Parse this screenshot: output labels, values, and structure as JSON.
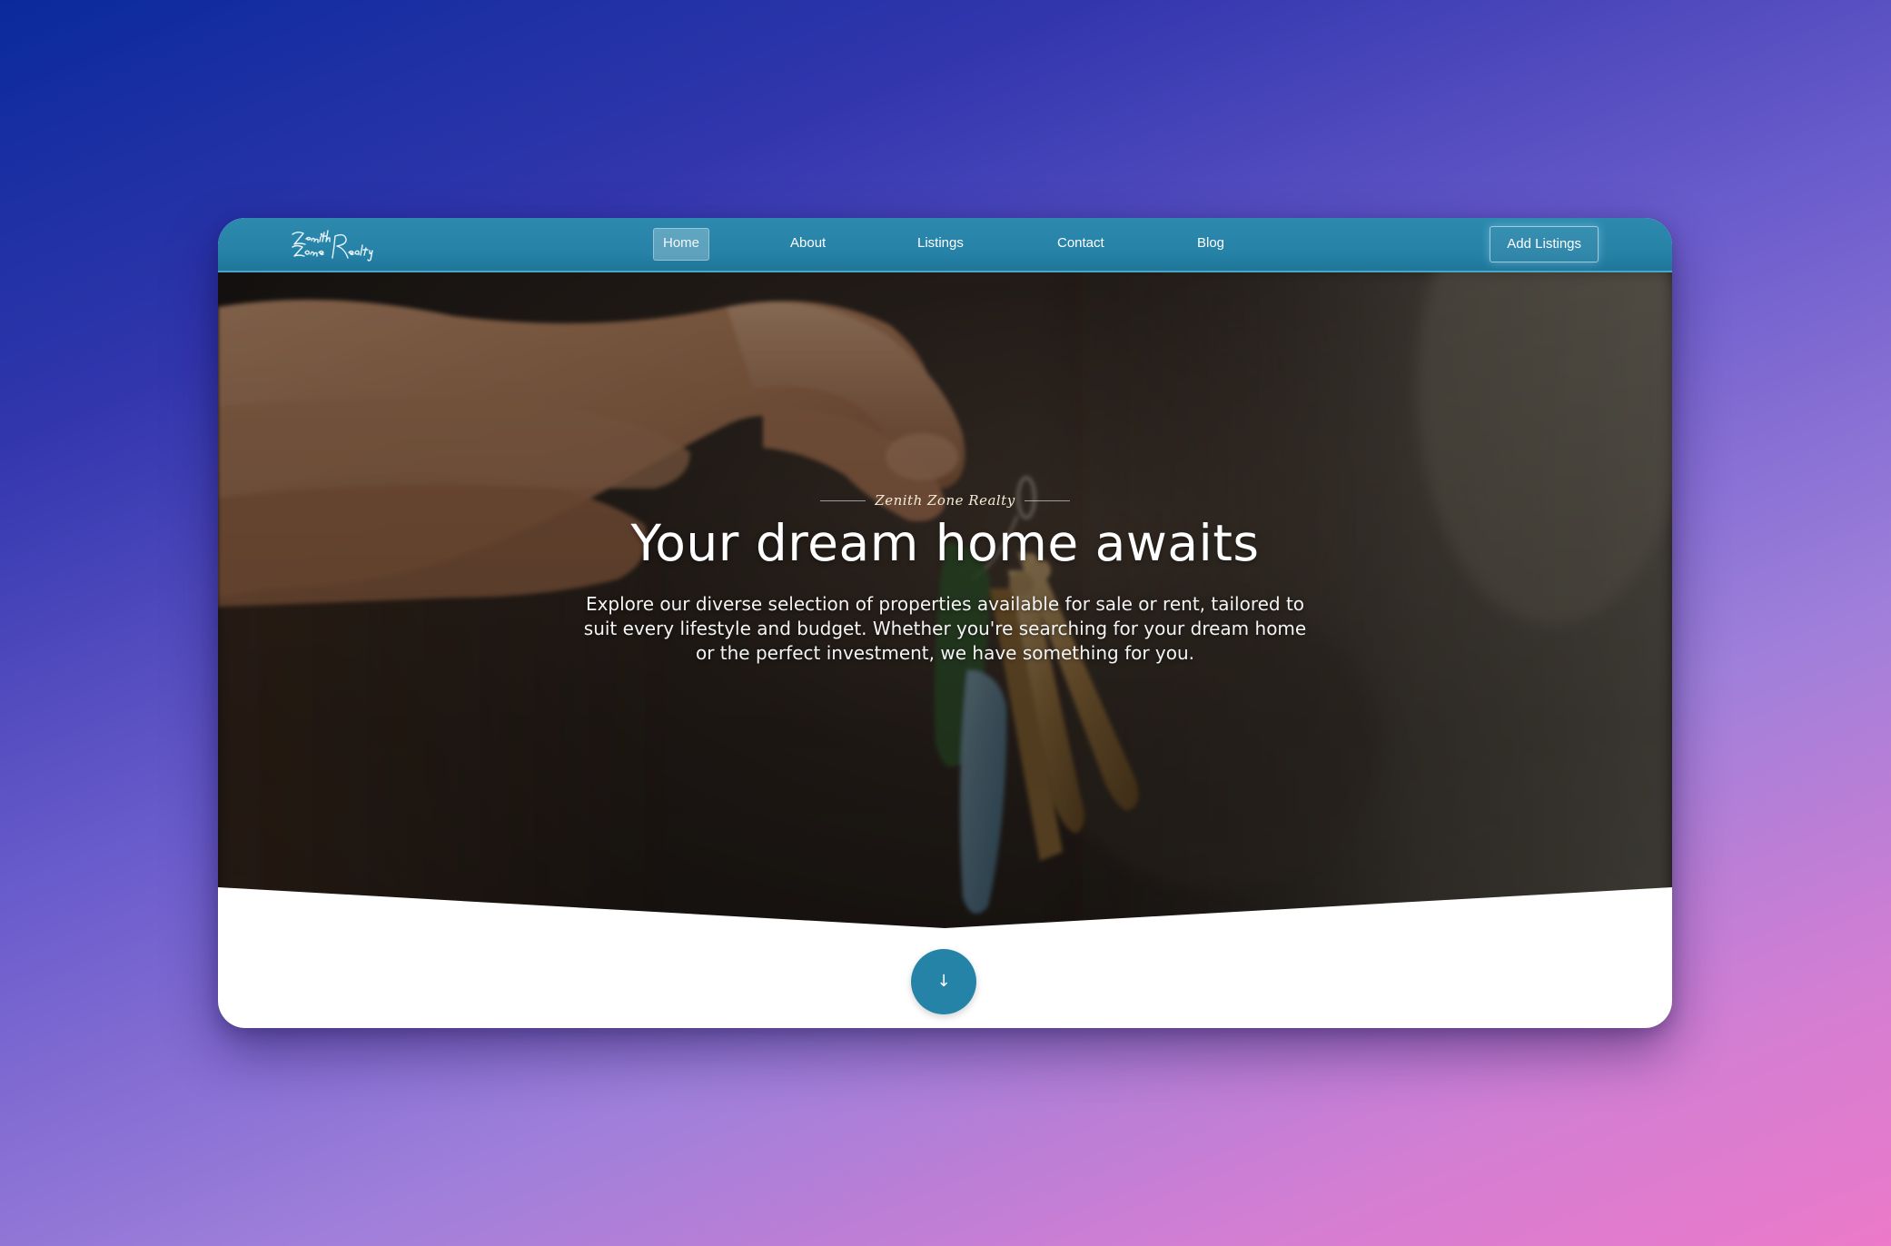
{
  "navbar": {
    "logo_text": "Zenith Zone Realty",
    "links": [
      {
        "label": "Home",
        "active": true
      },
      {
        "label": "About",
        "active": false
      },
      {
        "label": "Listings",
        "active": false
      },
      {
        "label": "Contact",
        "active": false
      },
      {
        "label": "Blog",
        "active": false
      }
    ],
    "cta_label": "Add Listings"
  },
  "hero": {
    "tagline": "Zenith Zone Realty",
    "title": "Your dream home awaits",
    "description": "Explore our diverse selection of properties available for sale or rent, tailored to suit every lifestyle and budget. Whether you're searching for your dream home or the perfect investment, we have something for you.",
    "scroll_icon": "arrow-down-icon",
    "scroll_glyph": "↓"
  },
  "colors": {
    "nav_bg": "#2581a6",
    "accent": "#2583a8",
    "page_bg_start": "#0a2a9c",
    "page_bg_end": "#ec79c9"
  }
}
